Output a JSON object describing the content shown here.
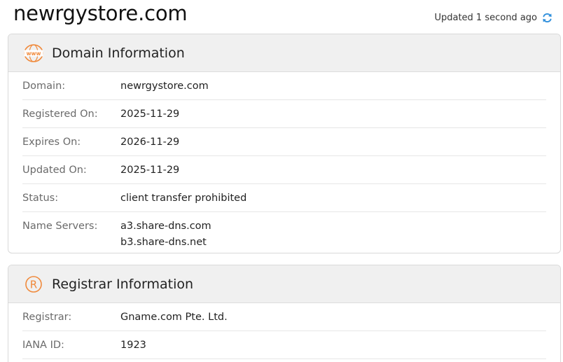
{
  "header": {
    "site_title": "newrgystore.com",
    "updated_text": "Updated 1 second ago"
  },
  "domain_info": {
    "title": "Domain Information",
    "icon": "www-icon",
    "rows": [
      {
        "label": "Domain:",
        "value": "newrgystore.com"
      },
      {
        "label": "Registered On:",
        "value": "2025-11-29"
      },
      {
        "label": "Expires On:",
        "value": "2026-11-29"
      },
      {
        "label": "Updated On:",
        "value": "2025-11-29"
      },
      {
        "label": "Status:",
        "value": "client transfer prohibited"
      }
    ],
    "name_servers": {
      "label": "Name Servers:",
      "values": [
        "a3.share-dns.com",
        "b3.share-dns.net"
      ]
    }
  },
  "registrar_info": {
    "title": "Registrar Information",
    "icon": "registered-icon",
    "rows": [
      {
        "label": "Registrar:",
        "value": "Gname.com Pte. Ltd."
      },
      {
        "label": "IANA ID:",
        "value": "1923"
      }
    ]
  },
  "colors": {
    "accent_orange": "#f08a3c",
    "refresh_blue": "#2f8fdc"
  }
}
